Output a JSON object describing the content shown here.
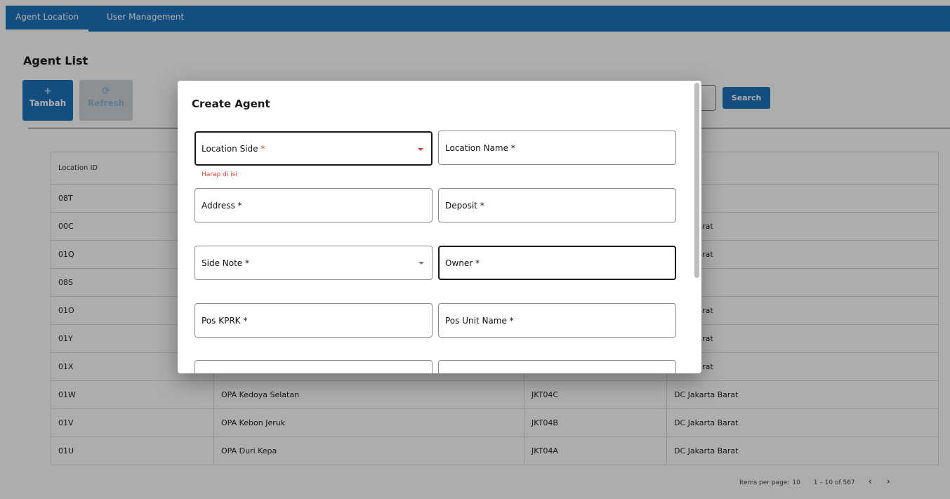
{
  "nav": {
    "tabs": [
      {
        "label": "Agent Location",
        "active": true
      },
      {
        "label": "User Management",
        "active": false
      }
    ]
  },
  "page": {
    "title": "Agent List",
    "add_button": {
      "icon": "plus-icon",
      "label": "Tambah"
    },
    "refresh_button": {
      "icon": "refresh-icon",
      "label": "Refresh"
    },
    "search_button": "Search"
  },
  "table": {
    "headers": [
      "Location ID",
      "",
      "",
      "n"
    ],
    "rows": [
      [
        "08T",
        "",
        "",
        ""
      ],
      [
        "00C",
        "",
        "",
        "arta Barat"
      ],
      [
        "01Q",
        "",
        "",
        "arta Barat"
      ],
      [
        "08S",
        "",
        "",
        ""
      ],
      [
        "01O",
        "",
        "",
        "arta Barat"
      ],
      [
        "01Y",
        "",
        "",
        "arta Barat"
      ],
      [
        "01X",
        "",
        "",
        "arta Barat"
      ],
      [
        "01W",
        "OPA Kedoya Selatan",
        "JKT04C",
        "DC Jakarta Barat"
      ],
      [
        "01V",
        "OPA Kebon Jeruk",
        "JKT04B",
        "DC Jakarta Barat"
      ],
      [
        "01U",
        "OPA Duri Kepa",
        "JKT04A",
        "DC Jakarta Barat"
      ]
    ]
  },
  "pager": {
    "items_per_page_label": "Items per page:",
    "items_per_page": "10",
    "range": "1 – 10 of 567",
    "prev": "‹",
    "next": "›"
  },
  "dialog": {
    "title": "Create Agent",
    "fields": {
      "location_side": {
        "label": "Location Side",
        "required_mark": "*",
        "error": "Harap di isi"
      },
      "location_name": {
        "label": "Location Name *"
      },
      "address": {
        "label": "Address *"
      },
      "deposit": {
        "label": "Deposit *"
      },
      "side_note": {
        "label": "Side Note *"
      },
      "owner": {
        "label": "Owner *"
      },
      "pos_kprk": {
        "label": "Pos KPRK *"
      },
      "pos_unit_name": {
        "label": "Pos Unit Name *"
      }
    }
  },
  "colors": {
    "primary": "#1e73be",
    "error": "#e53935"
  }
}
